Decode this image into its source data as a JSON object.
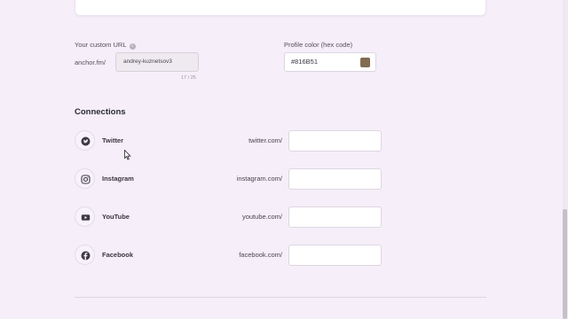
{
  "custom_url": {
    "label": "Your custom URL",
    "info_icon": "i",
    "prefix": "anchor.fm/",
    "value": "andrey-kuznetsov3",
    "char_count": "17 / 25"
  },
  "profile_color": {
    "label": "Profile color (hex code)",
    "value": "#816B51",
    "swatch_color": "#816B51"
  },
  "connections": {
    "title": "Connections",
    "items": [
      {
        "name": "Twitter",
        "domain": "twitter.com/",
        "icon": "twitter-icon",
        "value": ""
      },
      {
        "name": "Instagram",
        "domain": "instagram.com/",
        "icon": "instagram-icon",
        "value": ""
      },
      {
        "name": "YouTube",
        "domain": "youtube.com/",
        "icon": "youtube-icon",
        "value": ""
      },
      {
        "name": "Facebook",
        "domain": "facebook.com/",
        "icon": "facebook-icon",
        "value": ""
      }
    ]
  }
}
